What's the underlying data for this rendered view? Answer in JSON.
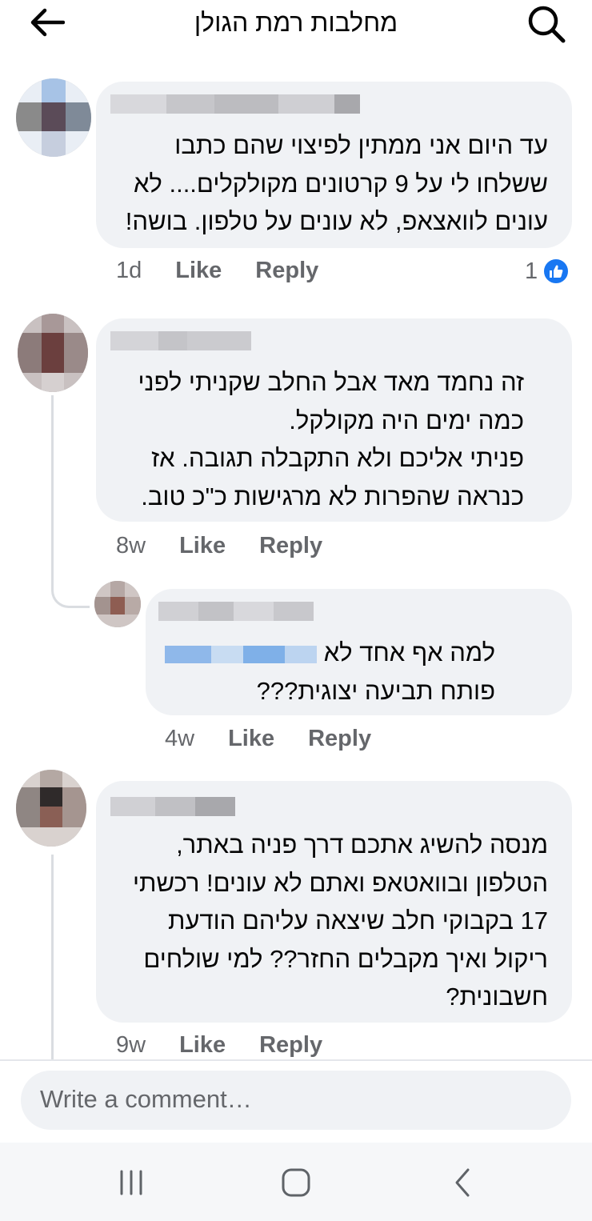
{
  "header": {
    "title": "מחלבות רמת הגולן",
    "back_icon": "arrow-left-icon",
    "search_icon": "search-icon"
  },
  "comments": [
    {
      "text_lines": [
        "עד היום אני ממתין לפיצוי שהם כתבו",
        "ששלחו לי על 9 קרטונים מקולקלים.... לא",
        "עונים לוואצאפ, לא עונים על טלפון. בושה!"
      ],
      "time": "1d",
      "like_label": "Like",
      "reply_label": "Reply",
      "reactions_count": "1"
    },
    {
      "text_lines": [
        "זה נחמד מאד אבל החלב שקניתי לפני",
        "כמה ימים היה מקולקל.",
        "פניתי אליכם ולא התקבלה תגובה. אז",
        "כנראה שהפרות לא מרגישות כ\"כ טוב."
      ],
      "time": "8w",
      "like_label": "Like",
      "reply_label": "Reply",
      "reply": {
        "text_line1": "למה אף אחד לא",
        "text_line2": "פותח תביעה יצוגית???",
        "time": "4w",
        "like_label": "Like",
        "reply_label": "Reply"
      }
    },
    {
      "text_lines": [
        "מנסה להשיג אתכם דרך פניה באתר,",
        "הטלפון ובוואטאפ ואתם לא עונים! רכשתי",
        "17 בקבוקי חלב שיצאה עליהם הודעת",
        "ריקול ואיך מקבלים החזר?? למי שולחים",
        "חשבונית?"
      ],
      "time": "9w",
      "like_label": "Like",
      "reply_label": "Reply"
    }
  ],
  "composer": {
    "placeholder": "Write a comment…"
  },
  "navbar": {
    "recents_icon": "recent-apps-icon",
    "home_icon": "home-icon",
    "back_icon": "nav-back-icon"
  },
  "colors": {
    "bubble": "#f0f2f5",
    "meta_text": "#65676b",
    "like_blue": "#1877f2"
  }
}
